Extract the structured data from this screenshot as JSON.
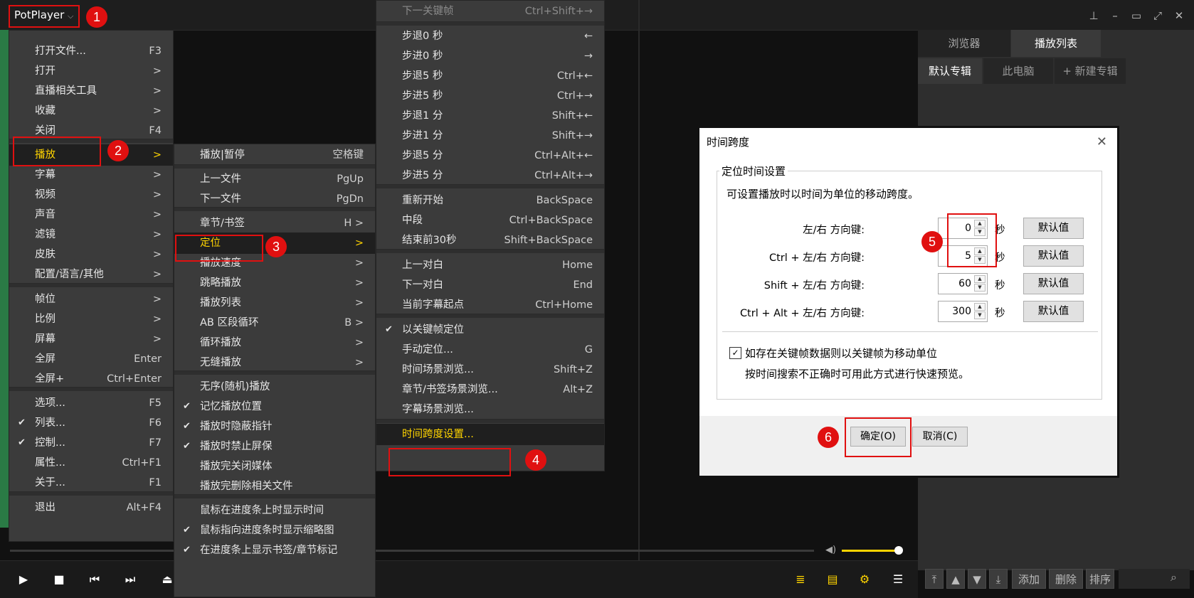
{
  "app": {
    "title": "PotPlayer"
  },
  "window_controls": [
    "pin",
    "minimize",
    "maximize",
    "fullscreen",
    "close"
  ],
  "main_menu": [
    {
      "label": "打开文件...",
      "shortcut": "F3"
    },
    {
      "label": "打开",
      "shortcut": ">"
    },
    {
      "label": "直播相关工具",
      "shortcut": ">"
    },
    {
      "label": "收藏",
      "shortcut": ">"
    },
    {
      "label": "关闭",
      "shortcut": "F4"
    },
    {
      "label": "播放",
      "shortcut": ">"
    },
    {
      "label": "字幕",
      "shortcut": ">"
    },
    {
      "label": "视频",
      "shortcut": ">"
    },
    {
      "label": "声音",
      "shortcut": ">"
    },
    {
      "label": "滤镜",
      "shortcut": ">"
    },
    {
      "label": "皮肤",
      "shortcut": ">"
    },
    {
      "label": "配置/语言/其他",
      "shortcut": ">"
    },
    {
      "label": "帧位",
      "shortcut": ">"
    },
    {
      "label": "比例",
      "shortcut": ">"
    },
    {
      "label": "屏幕",
      "shortcut": ">"
    },
    {
      "label": "全屏",
      "shortcut": "Enter"
    },
    {
      "label": "全屏+",
      "shortcut": "Ctrl+Enter"
    },
    {
      "label": "选项...",
      "shortcut": "F5"
    },
    {
      "label": "列表...",
      "shortcut": "F6"
    },
    {
      "label": "控制...",
      "shortcut": "F7"
    },
    {
      "label": "属性...",
      "shortcut": "Ctrl+F1"
    },
    {
      "label": "关于...",
      "shortcut": "F1"
    },
    {
      "label": "退出",
      "shortcut": "Alt+F4"
    }
  ],
  "play_menu": [
    {
      "label": "播放|暂停",
      "shortcut": "空格键"
    },
    {
      "label": "上一文件",
      "shortcut": "PgUp"
    },
    {
      "label": "下一文件",
      "shortcut": "PgDn"
    },
    {
      "label": "章节/书签",
      "shortcut": "H >"
    },
    {
      "label": "定位",
      "shortcut": ">"
    },
    {
      "label": "播放速度",
      "shortcut": ">"
    },
    {
      "label": "跳略播放",
      "shortcut": ">"
    },
    {
      "label": "播放列表",
      "shortcut": ">"
    },
    {
      "label": "AB 区段循环",
      "shortcut": "B >"
    },
    {
      "label": "循环播放",
      "shortcut": ">"
    },
    {
      "label": "无缝播放",
      "shortcut": ">"
    },
    {
      "label": "无序(随机)播放",
      "shortcut": ""
    },
    {
      "label": "记忆播放位置",
      "shortcut": ""
    },
    {
      "label": "播放时隐蔽指针",
      "shortcut": ""
    },
    {
      "label": "播放时禁止屏保",
      "shortcut": ""
    },
    {
      "label": "播放完关闭媒体",
      "shortcut": ""
    },
    {
      "label": "播放完删除相关文件",
      "shortcut": ""
    },
    {
      "label": "鼠标在进度条上时显示时间",
      "shortcut": ""
    },
    {
      "label": "鼠标指向进度条时显示缩略图",
      "shortcut": ""
    },
    {
      "label": "在进度条上显示书签/章节标记",
      "shortcut": ""
    }
  ],
  "seek_menu": [
    {
      "label": "下一关键帧",
      "shortcut": "Ctrl+Shift+→"
    },
    {
      "label": "步退0 秒",
      "shortcut": "←"
    },
    {
      "label": "步进0 秒",
      "shortcut": "→"
    },
    {
      "label": "步退5 秒",
      "shortcut": "Ctrl+←"
    },
    {
      "label": "步进5 秒",
      "shortcut": "Ctrl+→"
    },
    {
      "label": "步退1 分",
      "shortcut": "Shift+←"
    },
    {
      "label": "步进1 分",
      "shortcut": "Shift+→"
    },
    {
      "label": "步退5 分",
      "shortcut": "Ctrl+Alt+←"
    },
    {
      "label": "步进5 分",
      "shortcut": "Ctrl+Alt+→"
    },
    {
      "label": "重新开始",
      "shortcut": "BackSpace"
    },
    {
      "label": "中段",
      "shortcut": "Ctrl+BackSpace"
    },
    {
      "label": "结束前30秒",
      "shortcut": "Shift+BackSpace"
    },
    {
      "label": "上一对白",
      "shortcut": "Home"
    },
    {
      "label": "下一对白",
      "shortcut": "End"
    },
    {
      "label": "当前字幕起点",
      "shortcut": "Ctrl+Home"
    },
    {
      "label": "以关键帧定位",
      "shortcut": ""
    },
    {
      "label": "手动定位...",
      "shortcut": "G"
    },
    {
      "label": "时间场景浏览...",
      "shortcut": "Shift+Z"
    },
    {
      "label": "章节/书签场景浏览...",
      "shortcut": "Alt+Z"
    },
    {
      "label": "字幕场景浏览...",
      "shortcut": ""
    },
    {
      "label": "时间跨度设置...",
      "shortcut": ""
    }
  ],
  "annotations": [
    "1",
    "2",
    "3",
    "4",
    "5",
    "6"
  ],
  "playlist_panel": {
    "tabs": [
      "浏览器",
      "播放列表"
    ],
    "subtabs": [
      "默认专辑",
      "此电脑",
      "+ 新建专辑"
    ],
    "buttons": [
      "添加",
      "删除",
      "排序"
    ]
  },
  "dialog": {
    "title": "时间跨度",
    "group_title": "定位时间设置",
    "description": "可设置播放时以时间为单位的移动跨度。",
    "rows": [
      {
        "label": "左/右 方向键:",
        "value": "0",
        "unit": "秒",
        "default_btn": "默认值"
      },
      {
        "label": "Ctrl + 左/右 方向键:",
        "value": "5",
        "unit": "秒",
        "default_btn": "默认值"
      },
      {
        "label": "Shift + 左/右 方向键:",
        "value": "60",
        "unit": "秒",
        "default_btn": "默认值"
      },
      {
        "label": "Ctrl + Alt + 左/右 方向键:",
        "value": "300",
        "unit": "秒",
        "default_btn": "默认值"
      }
    ],
    "checkbox_label": "如存在关键帧数据则以关键帧为移动单位",
    "checkbox_note": "按时间搜索不正确时可用此方式进行快速预览。",
    "ok": "确定(O)",
    "cancel": "取消(C)"
  }
}
